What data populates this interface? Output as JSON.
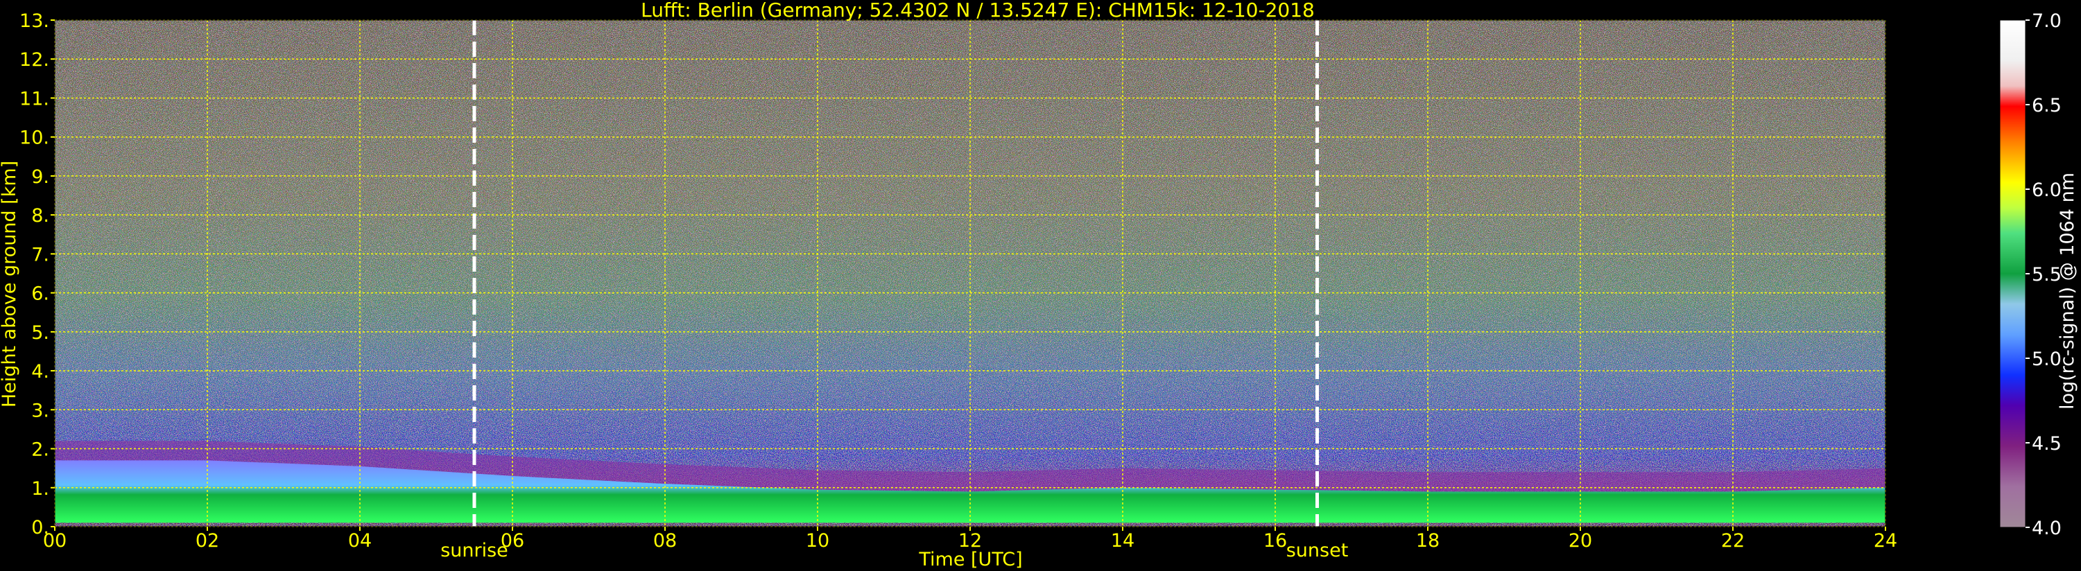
{
  "chart_data": {
    "type": "heatmap",
    "title": "Lufft: Berlin (Germany; 52.4302 N / 13.5247 E):    CHM15k: 12-10-2018",
    "xlabel": "Time [UTC]",
    "ylabel": "Height above ground [km]",
    "xlim": [
      0,
      24
    ],
    "ylim": [
      0,
      13
    ],
    "x_ticks": [
      0,
      2,
      4,
      6,
      8,
      10,
      12,
      14,
      16,
      18,
      20,
      22,
      24
    ],
    "x_tick_labels": [
      "00",
      "02",
      "04",
      "06",
      "08",
      "10",
      "12",
      "14",
      "16",
      "18",
      "20",
      "22",
      "24"
    ],
    "y_ticks": [
      0,
      1,
      2,
      3,
      4,
      5,
      6,
      7,
      8,
      9,
      10,
      11,
      12,
      13
    ],
    "y_tick_labels": [
      "0.",
      "1.",
      "2.",
      "3.",
      "4.",
      "5.",
      "6.",
      "7.",
      "8.",
      "9.",
      "10.",
      "11.",
      "12.",
      "13."
    ],
    "grid": true,
    "markers": [
      {
        "label": "sunrise",
        "x": 5.5
      },
      {
        "label": "sunset",
        "x": 16.55
      }
    ],
    "boundary_layer_top_km": {
      "x": [
        0,
        2,
        4,
        6,
        8,
        10,
        12,
        14,
        16,
        18,
        20,
        22,
        24
      ],
      "y": [
        1.7,
        1.7,
        1.55,
        1.3,
        1.1,
        0.95,
        0.9,
        1.0,
        0.95,
        0.9,
        0.9,
        0.9,
        1.0
      ]
    },
    "colorbar": {
      "label": "log(rc-signal) @ 1064 nm",
      "range": [
        4.0,
        7.0
      ],
      "ticks": [
        4.0,
        4.5,
        5.0,
        5.5,
        6.0,
        6.5,
        7.0
      ],
      "tick_labels": [
        "4.0",
        "4.5",
        "5.0",
        "5.5",
        "6.0",
        "6.5",
        "7.0"
      ]
    },
    "colors": {
      "text": "#ffff00",
      "grid": "#ffff00",
      "marker": "#ffffff",
      "background": "#000000"
    }
  }
}
